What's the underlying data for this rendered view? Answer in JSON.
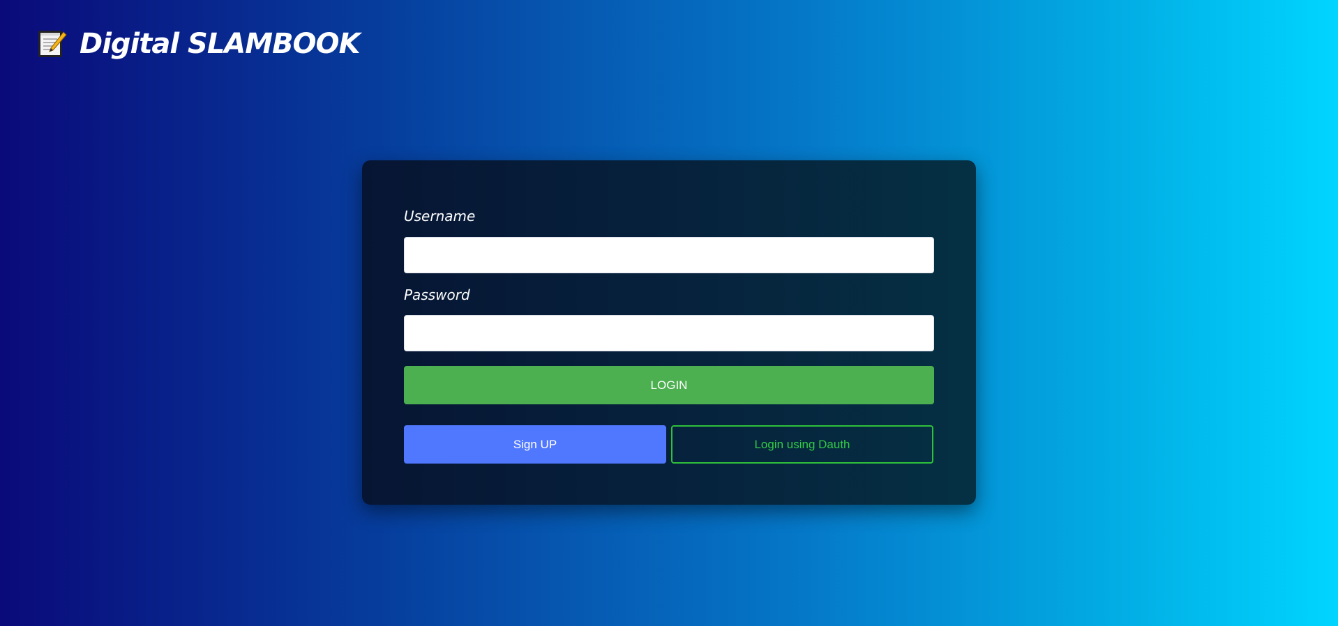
{
  "brand": {
    "title": "Digital SLAMBOOK",
    "icon": "memo-icon"
  },
  "login_form": {
    "username_label": "Username",
    "username_value": "",
    "password_label": "Password",
    "password_value": "",
    "login_button": "LOGIN",
    "signup_button": "Sign UP",
    "dauth_button": "Login using Dauth"
  },
  "colors": {
    "background_gradient": [
      "#0a0a7a",
      "#06409f",
      "#0578c8",
      "#02b0e6",
      "#00d5ff"
    ],
    "card": "#061533",
    "login_button": "#4caf50",
    "signup_button": "#5078ff",
    "dauth_accent": "#2fc13a"
  }
}
